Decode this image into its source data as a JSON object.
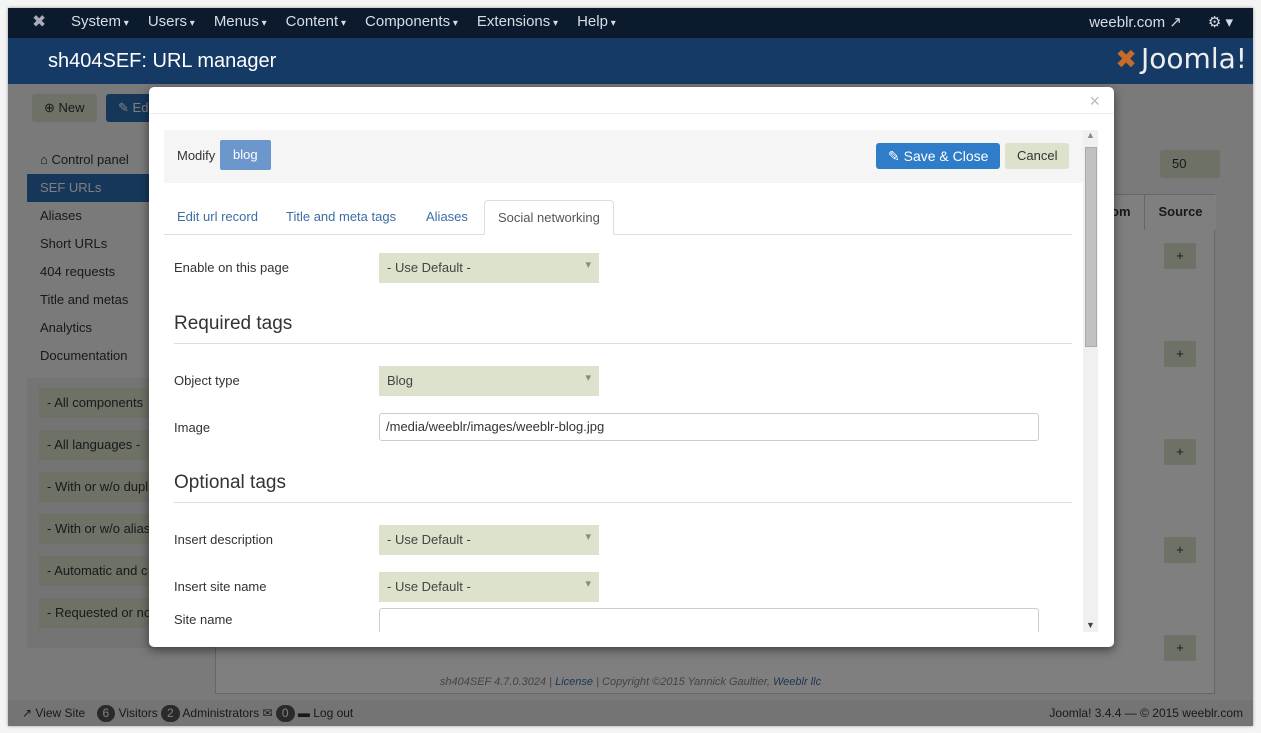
{
  "nav": {
    "menu": [
      "System",
      "Users",
      "Menus",
      "Content",
      "Components",
      "Extensions",
      "Help"
    ],
    "site_link": "weeblr.com"
  },
  "header": {
    "title": "sh404SEF: URL manager",
    "logo": "Joomla!"
  },
  "toolbar": {
    "new": "New",
    "edit": "Ed"
  },
  "sidebar": {
    "items": [
      "Control panel",
      "SEF URLs",
      "Aliases",
      "Short URLs",
      "404 requests",
      "Title and metas",
      "Analytics",
      "Documentation"
    ]
  },
  "filters": [
    "- All components",
    "- All languages -",
    "- With or w/o dupl",
    "- With or w/o alias",
    "- Automatic and c",
    "- Requested or no"
  ],
  "list": {
    "limit": "50",
    "columns": [
      "om",
      "Source"
    ],
    "plus": "+"
  },
  "footer": {
    "version": "sh404SEF 4.7.0.3024 |",
    "license": "License",
    "copyright": "| Copyright ©2015 Yannick Gaultier,",
    "company": "Weeblr llc"
  },
  "status": {
    "view_site": "View Site",
    "visitors_count": "6",
    "visitors": "Visitors",
    "admins_count": "2",
    "admins": "Administrators",
    "messages_count": "0",
    "logout": "Log out",
    "version": "Joomla! 3.4.4 — © 2015 weeblr.com"
  },
  "modal": {
    "close": "×",
    "modify": "Modify",
    "record": "blog",
    "save": "Save & Close",
    "cancel": "Cancel",
    "tabs": [
      "Edit url record",
      "Title and meta tags",
      "Aliases",
      "Social networking"
    ],
    "enable_label": "Enable on this page",
    "enable_value": "- Use Default -",
    "required_heading": "Required tags",
    "object_type_label": "Object type",
    "object_type_value": "Blog",
    "image_label": "Image",
    "image_value": "/media/weeblr/images/weeblr-blog.jpg",
    "optional_heading": "Optional tags",
    "desc_label": "Insert description",
    "desc_value": "- Use Default -",
    "sitename_label": "Insert site name",
    "sitename_value": "- Use Default -",
    "site_name_label": "Site name",
    "site_name_value": ""
  },
  "colors": {
    "primary": "#2f7dc9",
    "record_badge": "#6b97cc",
    "select_bg": "#dde2cc",
    "navbar": "#0c1a2e",
    "header": "#163a66"
  }
}
